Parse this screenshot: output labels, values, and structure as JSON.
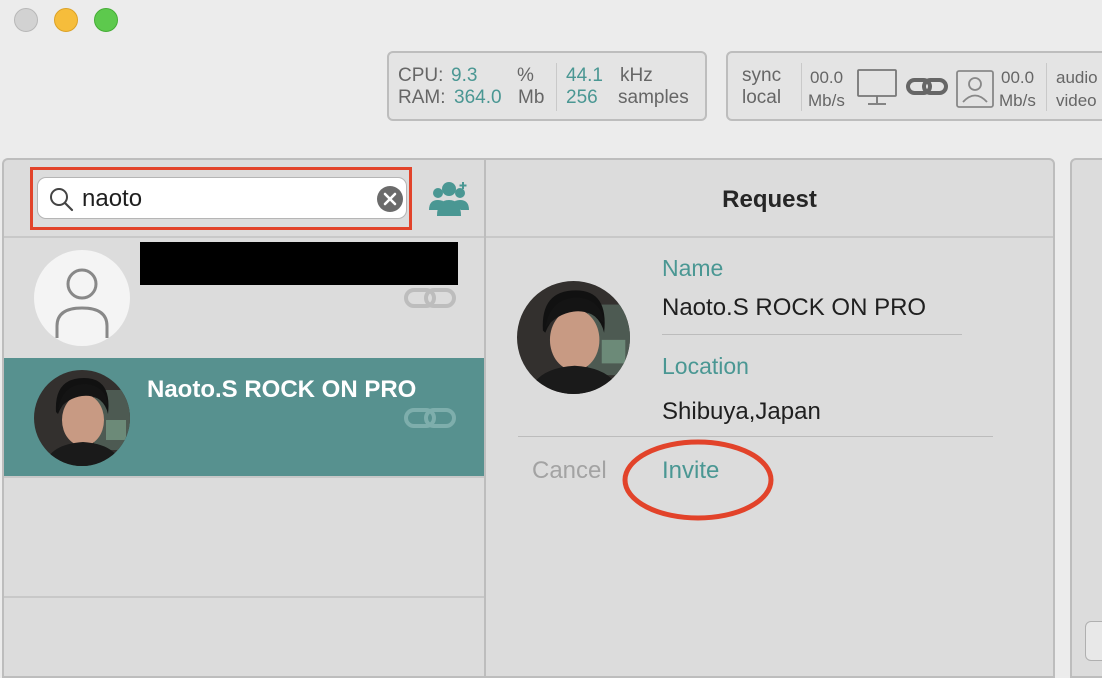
{
  "stats": {
    "cpu_label": "CPU:",
    "cpu_value": "9.3",
    "cpu_unit": "%",
    "ram_label": "RAM:",
    "ram_value": "364.0",
    "ram_unit": "Mb",
    "rate_value": "44.1",
    "rate_unit": "kHz",
    "buffer_value": "256",
    "buffer_unit": "samples"
  },
  "network": {
    "sync_line1": "sync",
    "sync_line2": "local",
    "out_value": "00.0",
    "out_unit": "Mb/s",
    "in_value": "00.0",
    "in_unit": "Mb/s",
    "media_line1": "audio",
    "media_line2": "video"
  },
  "search": {
    "value": "naoto"
  },
  "results": [
    {
      "name": "",
      "redacted": true,
      "selected": false
    },
    {
      "name": "Naoto.S ROCK ON PRO",
      "redacted": false,
      "selected": true
    }
  ],
  "request": {
    "title": "Request",
    "name_label": "Name",
    "name_value": "Naoto.S ROCK ON PRO",
    "location_label": "Location",
    "location_value": "Shibuya,Japan",
    "cancel_label": "Cancel",
    "invite_label": "Invite"
  },
  "colors": {
    "accent": "#4a9793",
    "selected_row": "#57918f",
    "highlight": "#e2432a"
  }
}
